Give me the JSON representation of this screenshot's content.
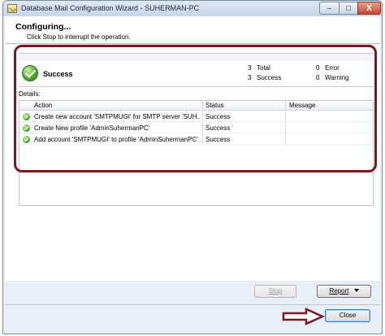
{
  "window": {
    "title": "Database Mail Configuration Wizard - SUHERMAN-PC",
    "min_glyph": "–",
    "max_glyph": "□",
    "close_glyph": "X"
  },
  "header": {
    "title": "Configuring...",
    "subtitle": "Click Stop to interrupt the operation."
  },
  "summary": {
    "status": "Success",
    "total_count": "3",
    "total_label": "Total",
    "success_count": "3",
    "success_label": "Success",
    "error_count": "0",
    "error_label": "Error",
    "warning_count": "0",
    "warning_label": "Warning"
  },
  "details": {
    "label": "Details:",
    "columns": [
      "Action",
      "Status",
      "Message"
    ],
    "rows": [
      {
        "action": "Create new account 'SMTPMUGI' for SMTP server 'SUH...",
        "status": "Success",
        "message": ""
      },
      {
        "action": "Create New profile 'AdminSuhermanPC'",
        "status": "Success",
        "message": ""
      },
      {
        "action": "Add account 'SMTPMUGI' to profile 'AdminSuhermanPC' ...",
        "status": "Success",
        "message": ""
      }
    ]
  },
  "buttons": {
    "stop": "Stop",
    "report": "Report",
    "close": "Close"
  },
  "colors": {
    "annotation": "#7d1622",
    "success_green": "#4aa82a"
  }
}
